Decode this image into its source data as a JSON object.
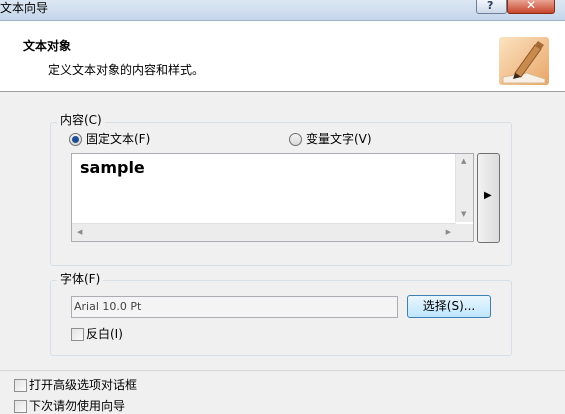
{
  "window": {
    "title": "文本向导",
    "help_glyph": "?",
    "close_glyph": "✕"
  },
  "header": {
    "title": "文本对象",
    "subtitle": "定义文本对象的内容和样式。",
    "icon": "pen-paper-icon"
  },
  "content_group": {
    "label": "内容(C)",
    "radio_fixed_label": "固定文本(F)",
    "radio_fixed_selected": true,
    "radio_variable_label": "变量文字(V)",
    "radio_variable_selected": false,
    "text_value": "sample",
    "side_button_glyph": "▶"
  },
  "font_group": {
    "label": "字体(F)",
    "font_value": "Arial 10.0 Pt",
    "select_button_label": "选择(S)...",
    "invert_label": "反白(I)",
    "invert_checked": false
  },
  "footer": {
    "open_advanced_label": "打开高级选项对话框",
    "open_advanced_checked": false,
    "no_wizard_label": "下次请勿使用向导",
    "no_wizard_checked": false
  },
  "colors": {
    "header_bg": "#ffffff",
    "dialog_bg": "#f0f0f0",
    "radio_dot": "#1d4f96",
    "close_button": "#c7452c"
  }
}
